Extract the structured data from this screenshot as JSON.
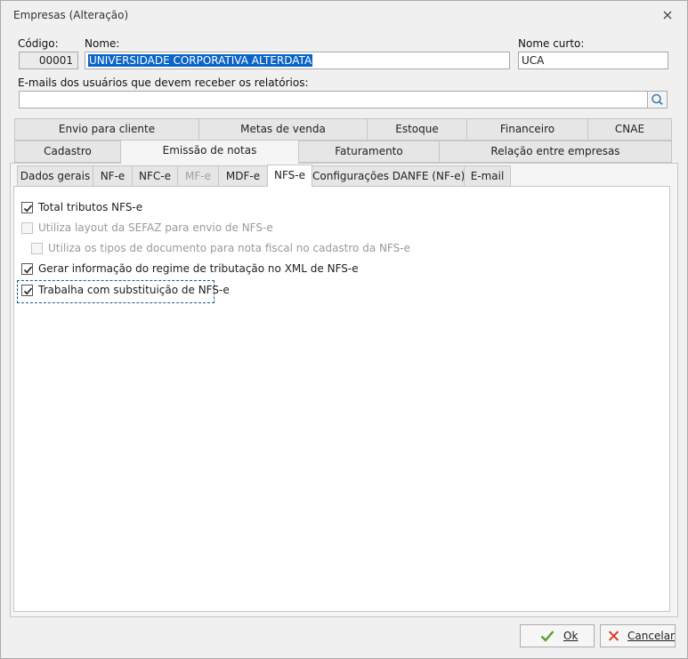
{
  "window": {
    "title": "Empresas (Alteração)"
  },
  "header": {
    "codigo_label": "Código:",
    "codigo_value": "00001",
    "nome_label": "Nome:",
    "nome_value": "UNIVERSIDADE CORPORATIVA ALTERDATA",
    "nome_curto_label": "Nome curto:",
    "nome_curto_value": "UCA",
    "emails_label": "E-mails dos usuários que devem receber os relatórios:",
    "emails_value": ""
  },
  "main_tabs_row1": [
    "Envio para cliente",
    "Metas de venda",
    "Estoque",
    "Financeiro",
    "CNAE"
  ],
  "main_tabs_row2": [
    "Cadastro",
    "Emissão de notas",
    "Faturamento",
    "Relação entre empresas"
  ],
  "sub_tabs": [
    "Dados gerais",
    "NF-e",
    "NFC-e",
    "MF-e",
    "MDF-e",
    "NFS-e",
    "Configurações DANFE (NF-e)",
    "E-mail"
  ],
  "options": [
    {
      "label": "Total tributos NFS-e",
      "checked": true,
      "enabled": true
    },
    {
      "label": "Utiliza layout da SEFAZ para envio de NFS-e",
      "checked": false,
      "enabled": false
    },
    {
      "label": "Utiliza os tipos de documento para nota fiscal no cadastro da NFS-e",
      "checked": false,
      "enabled": false
    },
    {
      "label": "Gerar informação do regime de tributação no XML de NFS-e",
      "checked": true,
      "enabled": true
    },
    {
      "label": "Trabalha com substituição de NFS-e",
      "checked": true,
      "enabled": true
    }
  ],
  "footer": {
    "ok_label": "Ok",
    "cancel_label": "Cancelar"
  },
  "colors": {
    "ok_check": "#5aa02c",
    "cancel_x": "#d9381e",
    "selection": "#0a64c8",
    "focus_border": "#1a5f8a"
  }
}
